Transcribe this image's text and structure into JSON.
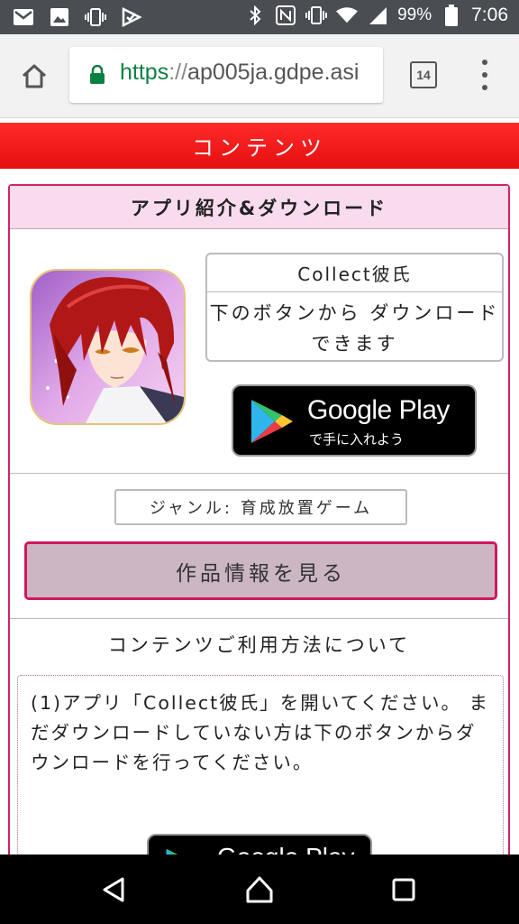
{
  "status_bar": {
    "battery_percent": "99%",
    "time": "7:06"
  },
  "browser": {
    "url_scheme": "https",
    "url_separator": "://",
    "url_host": "ap005ja.gdpe.asi",
    "tab_count": "14"
  },
  "page": {
    "header": "コンテンツ",
    "card_title": "アプリ紹介&ダウンロード",
    "app_name": "Collect彼氏",
    "download_text": "下のボタンから ダウンロードできます",
    "google_play": {
      "title": "Google Play",
      "subtitle": "で手に入れよう"
    },
    "genre": "ジャンル: 育成放置ゲーム",
    "details_button": "作品情報を見る",
    "howto_title": "コンテンツご利用方法について",
    "step1_text": "(1)アプリ「Collect彼氏」を開いてください。 まだダウンロードしていない方は下のボタンからダウンロードを行ってください。",
    "google_play2_title": "Google Play"
  },
  "colors": {
    "header_red": "#ee1a1a",
    "card_border": "#d0236a",
    "card_title_bg": "#f8dcee",
    "button_bg": "#ccb6c3",
    "url_scheme_green": "#0b8043"
  }
}
